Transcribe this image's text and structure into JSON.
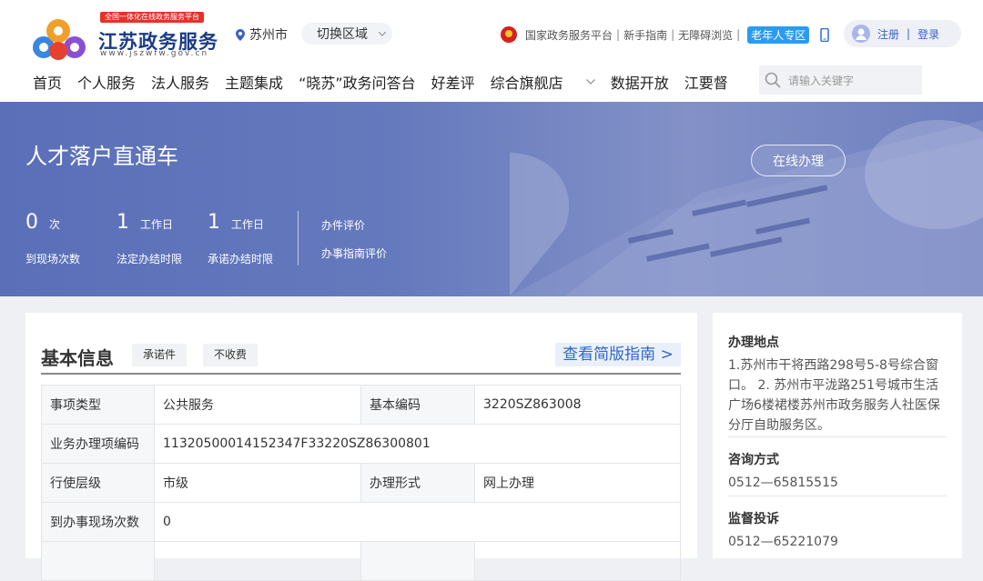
{
  "header": {
    "logo_tag": "全国一体化在线政务服务平台",
    "logo_title": "江苏政务服务",
    "logo_url": "www.jszwfw.gov.cn",
    "city": "苏州市",
    "switch_label": "切换区域",
    "links": [
      "国家政务服务平台",
      "新手指南",
      "无障碍浏览"
    ],
    "elder_label": "老年人专区",
    "register": "注册",
    "login_sep": "|",
    "login": "登录"
  },
  "nav": {
    "items": [
      "首页",
      "个人服务",
      "法人服务",
      "主题集成",
      "“晓苏”政务问答台",
      "好差评",
      "综合旗舰店",
      "数据开放",
      "江要督"
    ],
    "search_placeholder": "请输入关键字"
  },
  "banner": {
    "title": "人才落户直通车",
    "online_button": "在线办理",
    "stats": [
      {
        "value": "0",
        "unit": "次",
        "label": "到现场次数"
      },
      {
        "value": "1",
        "unit": "工作日",
        "label": "法定办结时限"
      },
      {
        "value": "1",
        "unit": "工作日",
        "label": "承诺办结时限"
      }
    ],
    "eval_links": [
      "办件评价",
      "办事指南评价"
    ]
  },
  "basic": {
    "title": "基本信息",
    "tags": [
      "承诺件",
      "不收费"
    ],
    "guide_button": "查看简版指南 >",
    "rows": [
      {
        "k1": "事项类型",
        "v1": "公共服务",
        "k2": "基本编码",
        "v2": "3220SZ863008"
      },
      {
        "k1": "业务办理项编码",
        "v1": "11320500014152347F33220SZ86300801"
      },
      {
        "k1": "行使层级",
        "v1": "市级",
        "k2": "办理形式",
        "v2": "网上办理"
      },
      {
        "k1": "到办事现场次数",
        "v1": "0"
      }
    ]
  },
  "side": {
    "location_title": "办理地点",
    "location_text": "1.苏州市干将西路298号5-8号综合窗口。 2. 苏州市平泷路251号城市生活广场6楼裙楼苏州市政务服务人社医保分厅自助服务区。",
    "consult_title": "咨询方式",
    "consult_text": "0512—65815515",
    "supervise_title": "监督投诉",
    "supervise_text": "0512—65221079"
  },
  "colors": {
    "brand": "#1a3b87",
    "accent": "#2f66c9",
    "banner": "#6579bd",
    "elder": "#2b9bf0",
    "tag_red": "#e4322b"
  }
}
